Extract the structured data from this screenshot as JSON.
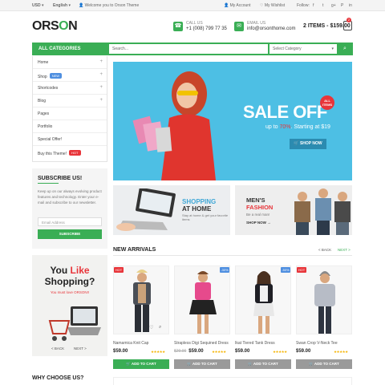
{
  "topbar": {
    "currency": "USD",
    "language": "English",
    "welcome": "Welcome you to Orson Theme",
    "my_account": "My Account",
    "wishlist": "My Wishlist",
    "follow": "Follow:",
    "social": [
      "f",
      "t",
      "g+",
      "P",
      "in"
    ]
  },
  "header": {
    "logo_part1": "ORS",
    "logo_o": "O",
    "logo_part2": "N",
    "call_label": "CALL US",
    "call_value": "+1 (008) 799 77 35",
    "email_label": "EMAIL US",
    "email_value": "info@orsonthome.com",
    "cart_text": "2 ITEMS - $159.00",
    "cart_count": "2"
  },
  "catbar": {
    "label": "ALL CATEGORIES",
    "search_placeholder": "Search...",
    "select_label": "Select Category"
  },
  "menu": {
    "items": [
      {
        "label": "Home",
        "plus": "+"
      },
      {
        "label": "Shop",
        "tag": "NEW",
        "plus": "+"
      },
      {
        "label": "Shortcodes",
        "plus": "+"
      },
      {
        "label": "Blog",
        "plus": "+"
      },
      {
        "label": "Pages",
        "plus": ""
      },
      {
        "label": "Portfolio",
        "plus": ""
      },
      {
        "label": "Special Offer!",
        "plus": ""
      },
      {
        "label": "Buy this Theme!",
        "tag": "HOT",
        "plus": ""
      }
    ]
  },
  "subscribe": {
    "title": "SUBSCRIBE US!",
    "text": "Keep up on our always evolving product features and technology. Enter your e-mail and subscribe to our newsletter.",
    "placeholder": "Email Address",
    "button": "SUBSCRIBE"
  },
  "hero": {
    "title": "SALE OFF",
    "badge": "ALL ITEMS",
    "subtitle_prefix": "up to ",
    "subtitle_pct": "70%",
    "subtitle_suffix": ". Starting at $19",
    "button": "SHOP NOW"
  },
  "banners": {
    "shopping_line1": "SHOPPING",
    "shopping_line2": "AT HOME",
    "shopping_text": "Stay at home & get your favorite items",
    "fashion_line1": "MEN'S",
    "fashion_line2": "FASHION",
    "fashion_text": "Be a real man!",
    "fashion_button": "SHOP NOW"
  },
  "promo": {
    "line1_a": "You ",
    "line1_b": "Like",
    "line2": "Shopping?",
    "sub": "You must love ORSON!!",
    "back": "< BACK",
    "next": "NEXT >"
  },
  "new_arrivals": {
    "title": "NEW ARRIVALS",
    "back": "< BACK",
    "next": "NEXT >",
    "products": [
      {
        "name": "Namamica Knit Cap",
        "price": "$59.00",
        "old": "",
        "badge": "HOT",
        "stars": "★★★★★",
        "button": "ADD TO CART"
      },
      {
        "name": "Strapless Digi Sequined Dress",
        "price": "$59.00",
        "old": "$29.00",
        "badge": "-30%",
        "stars": "★★★★★",
        "button": "ADD TO CART"
      },
      {
        "name": "Ikat Tiered Tank Dress",
        "price": "$59.00",
        "old": "",
        "badge": "-50%",
        "stars": "★★★★★",
        "button": "ADD TO CART"
      },
      {
        "name": "Swan Crop V-Neck Tee",
        "price": "$59.00",
        "old": "",
        "badge": "HOT",
        "stars": "★★★★★",
        "button": "ADD TO CART"
      }
    ]
  },
  "why": {
    "title": "WHY CHOOSE US?"
  },
  "colors": {
    "accent": "#3aae55",
    "sky": "#4dbfe4",
    "red": "#e8353a",
    "blue": "#4f8fe0",
    "grey_btn": "#9a9a9a"
  }
}
